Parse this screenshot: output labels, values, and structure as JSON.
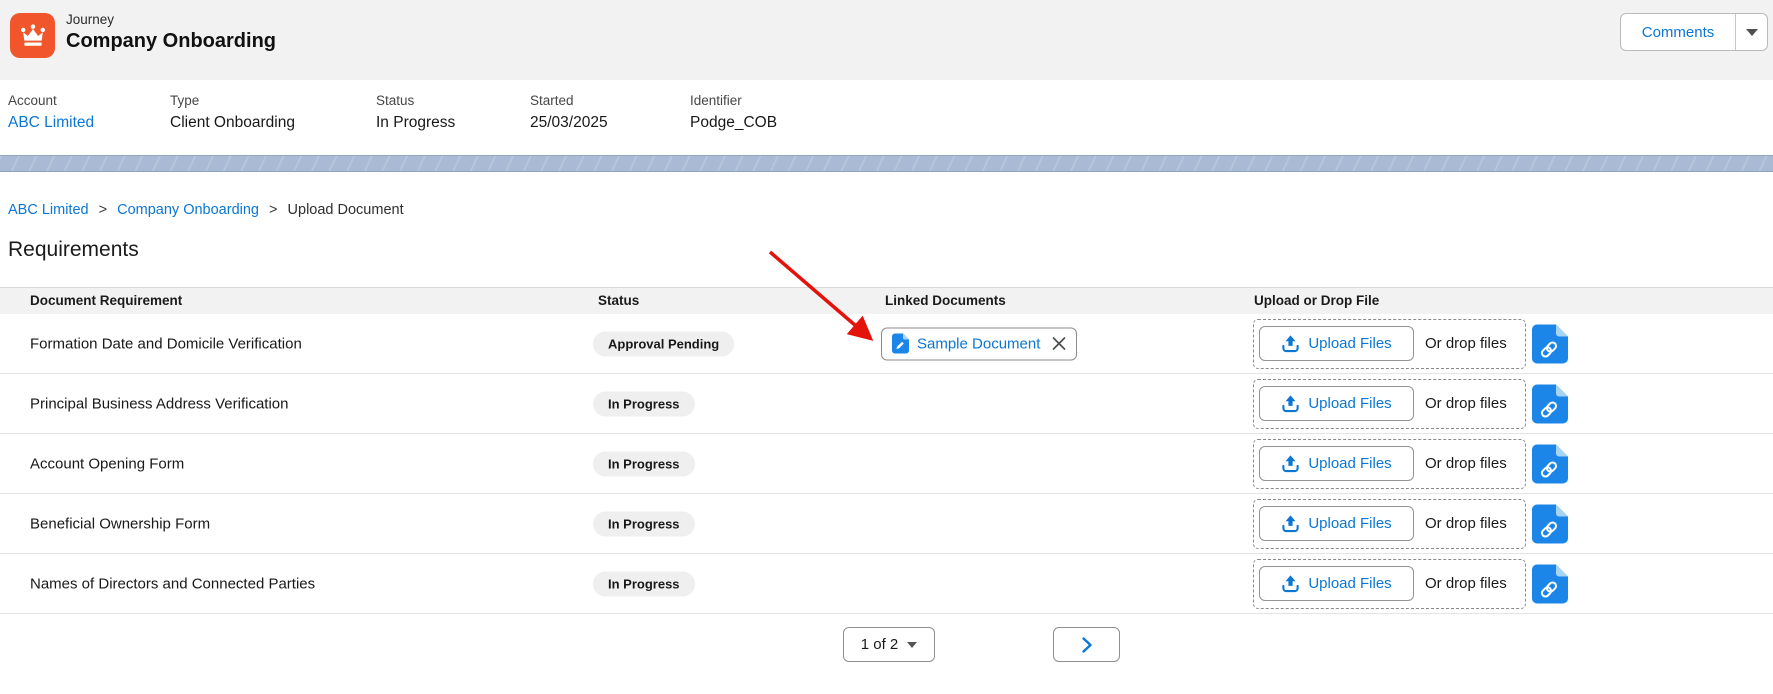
{
  "header": {
    "entity_label": "Journey",
    "title": "Company Onboarding",
    "comments_label": "Comments"
  },
  "fields": [
    {
      "label": "Account",
      "value": "ABC Limited"
    },
    {
      "label": "Type",
      "value": "Client Onboarding"
    },
    {
      "label": "Status",
      "value": "In Progress"
    },
    {
      "label": "Started",
      "value": "25/03/2025"
    },
    {
      "label": "Identifier",
      "value": "Podge_COB"
    }
  ],
  "breadcrumb": [
    {
      "label": "ABC Limited"
    },
    {
      "label": "Company Onboarding"
    },
    {
      "label": "Upload Document"
    }
  ],
  "section_title": "Requirements",
  "table": {
    "columns": [
      "Document Requirement",
      "Status",
      "Linked Documents",
      "Upload or Drop File"
    ],
    "rows": [
      {
        "requirement": "Formation Date and Domicile Verification",
        "status": "Approval Pending",
        "linked_document": "Sample Document"
      },
      {
        "requirement": "Principal Business Address Verification",
        "status": "In Progress",
        "linked_document": null
      },
      {
        "requirement": "Account Opening Form",
        "status": "In Progress",
        "linked_document": null
      },
      {
        "requirement": "Beneficial Ownership Form",
        "status": "In Progress",
        "linked_document": null
      },
      {
        "requirement": "Names of Directors and Connected Parties",
        "status": "In Progress",
        "linked_document": null
      }
    ],
    "upload_button_label": "Upload Files",
    "drop_label": "Or drop files"
  },
  "pagination": {
    "page_indicator": "1 of 2"
  },
  "icons": {
    "entity": "crown-icon",
    "comments_caret": "caret-down-icon",
    "chip_file": "document-icon",
    "chip_close": "close-icon",
    "upload": "upload-icon",
    "link_file": "link-file-icon",
    "next": "chevron-right-icon",
    "annotation": "red-arrow"
  },
  "colors": {
    "accent": "#0b76d4",
    "brand_orange": "#f0552c",
    "banner": "#a9bad4",
    "pill_bg": "#f0efef",
    "arrow": "#e3120b",
    "file_blue": "#1b86e8",
    "file_fold": "#a8d3f3"
  }
}
